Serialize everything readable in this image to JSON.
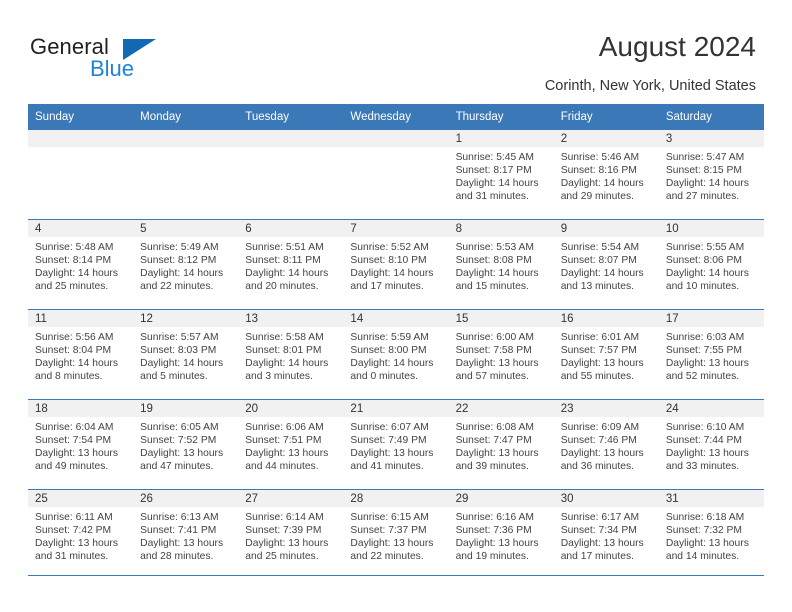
{
  "brand": {
    "name_part1": "General",
    "name_part2": "Blue",
    "accent_color": "#1f83d6",
    "triangle_color": "#1268b3"
  },
  "header": {
    "title": "August 2024",
    "location": "Corinth, New York, United States"
  },
  "calendar": {
    "header_bg": "#3b78b7",
    "daynum_bg": "#f1f1f1",
    "weekdays": [
      "Sunday",
      "Monday",
      "Tuesday",
      "Wednesday",
      "Thursday",
      "Friday",
      "Saturday"
    ],
    "labels": {
      "sunrise": "Sunrise:",
      "sunset": "Sunset:",
      "daylight": "Daylight:"
    },
    "weeks": [
      [
        {
          "day": "",
          "sunrise": "",
          "sunset": "",
          "daylight": ""
        },
        {
          "day": "",
          "sunrise": "",
          "sunset": "",
          "daylight": ""
        },
        {
          "day": "",
          "sunrise": "",
          "sunset": "",
          "daylight": ""
        },
        {
          "day": "",
          "sunrise": "",
          "sunset": "",
          "daylight": ""
        },
        {
          "day": "1",
          "sunrise": "Sunrise: 5:45 AM",
          "sunset": "Sunset: 8:17 PM",
          "daylight": "Daylight: 14 hours and 31 minutes."
        },
        {
          "day": "2",
          "sunrise": "Sunrise: 5:46 AM",
          "sunset": "Sunset: 8:16 PM",
          "daylight": "Daylight: 14 hours and 29 minutes."
        },
        {
          "day": "3",
          "sunrise": "Sunrise: 5:47 AM",
          "sunset": "Sunset: 8:15 PM",
          "daylight": "Daylight: 14 hours and 27 minutes."
        }
      ],
      [
        {
          "day": "4",
          "sunrise": "Sunrise: 5:48 AM",
          "sunset": "Sunset: 8:14 PM",
          "daylight": "Daylight: 14 hours and 25 minutes."
        },
        {
          "day": "5",
          "sunrise": "Sunrise: 5:49 AM",
          "sunset": "Sunset: 8:12 PM",
          "daylight": "Daylight: 14 hours and 22 minutes."
        },
        {
          "day": "6",
          "sunrise": "Sunrise: 5:51 AM",
          "sunset": "Sunset: 8:11 PM",
          "daylight": "Daylight: 14 hours and 20 minutes."
        },
        {
          "day": "7",
          "sunrise": "Sunrise: 5:52 AM",
          "sunset": "Sunset: 8:10 PM",
          "daylight": "Daylight: 14 hours and 17 minutes."
        },
        {
          "day": "8",
          "sunrise": "Sunrise: 5:53 AM",
          "sunset": "Sunset: 8:08 PM",
          "daylight": "Daylight: 14 hours and 15 minutes."
        },
        {
          "day": "9",
          "sunrise": "Sunrise: 5:54 AM",
          "sunset": "Sunset: 8:07 PM",
          "daylight": "Daylight: 14 hours and 13 minutes."
        },
        {
          "day": "10",
          "sunrise": "Sunrise: 5:55 AM",
          "sunset": "Sunset: 8:06 PM",
          "daylight": "Daylight: 14 hours and 10 minutes."
        }
      ],
      [
        {
          "day": "11",
          "sunrise": "Sunrise: 5:56 AM",
          "sunset": "Sunset: 8:04 PM",
          "daylight": "Daylight: 14 hours and 8 minutes."
        },
        {
          "day": "12",
          "sunrise": "Sunrise: 5:57 AM",
          "sunset": "Sunset: 8:03 PM",
          "daylight": "Daylight: 14 hours and 5 minutes."
        },
        {
          "day": "13",
          "sunrise": "Sunrise: 5:58 AM",
          "sunset": "Sunset: 8:01 PM",
          "daylight": "Daylight: 14 hours and 3 minutes."
        },
        {
          "day": "14",
          "sunrise": "Sunrise: 5:59 AM",
          "sunset": "Sunset: 8:00 PM",
          "daylight": "Daylight: 14 hours and 0 minutes."
        },
        {
          "day": "15",
          "sunrise": "Sunrise: 6:00 AM",
          "sunset": "Sunset: 7:58 PM",
          "daylight": "Daylight: 13 hours and 57 minutes."
        },
        {
          "day": "16",
          "sunrise": "Sunrise: 6:01 AM",
          "sunset": "Sunset: 7:57 PM",
          "daylight": "Daylight: 13 hours and 55 minutes."
        },
        {
          "day": "17",
          "sunrise": "Sunrise: 6:03 AM",
          "sunset": "Sunset: 7:55 PM",
          "daylight": "Daylight: 13 hours and 52 minutes."
        }
      ],
      [
        {
          "day": "18",
          "sunrise": "Sunrise: 6:04 AM",
          "sunset": "Sunset: 7:54 PM",
          "daylight": "Daylight: 13 hours and 49 minutes."
        },
        {
          "day": "19",
          "sunrise": "Sunrise: 6:05 AM",
          "sunset": "Sunset: 7:52 PM",
          "daylight": "Daylight: 13 hours and 47 minutes."
        },
        {
          "day": "20",
          "sunrise": "Sunrise: 6:06 AM",
          "sunset": "Sunset: 7:51 PM",
          "daylight": "Daylight: 13 hours and 44 minutes."
        },
        {
          "day": "21",
          "sunrise": "Sunrise: 6:07 AM",
          "sunset": "Sunset: 7:49 PM",
          "daylight": "Daylight: 13 hours and 41 minutes."
        },
        {
          "day": "22",
          "sunrise": "Sunrise: 6:08 AM",
          "sunset": "Sunset: 7:47 PM",
          "daylight": "Daylight: 13 hours and 39 minutes."
        },
        {
          "day": "23",
          "sunrise": "Sunrise: 6:09 AM",
          "sunset": "Sunset: 7:46 PM",
          "daylight": "Daylight: 13 hours and 36 minutes."
        },
        {
          "day": "24",
          "sunrise": "Sunrise: 6:10 AM",
          "sunset": "Sunset: 7:44 PM",
          "daylight": "Daylight: 13 hours and 33 minutes."
        }
      ],
      [
        {
          "day": "25",
          "sunrise": "Sunrise: 6:11 AM",
          "sunset": "Sunset: 7:42 PM",
          "daylight": "Daylight: 13 hours and 31 minutes."
        },
        {
          "day": "26",
          "sunrise": "Sunrise: 6:13 AM",
          "sunset": "Sunset: 7:41 PM",
          "daylight": "Daylight: 13 hours and 28 minutes."
        },
        {
          "day": "27",
          "sunrise": "Sunrise: 6:14 AM",
          "sunset": "Sunset: 7:39 PM",
          "daylight": "Daylight: 13 hours and 25 minutes."
        },
        {
          "day": "28",
          "sunrise": "Sunrise: 6:15 AM",
          "sunset": "Sunset: 7:37 PM",
          "daylight": "Daylight: 13 hours and 22 minutes."
        },
        {
          "day": "29",
          "sunrise": "Sunrise: 6:16 AM",
          "sunset": "Sunset: 7:36 PM",
          "daylight": "Daylight: 13 hours and 19 minutes."
        },
        {
          "day": "30",
          "sunrise": "Sunrise: 6:17 AM",
          "sunset": "Sunset: 7:34 PM",
          "daylight": "Daylight: 13 hours and 17 minutes."
        },
        {
          "day": "31",
          "sunrise": "Sunrise: 6:18 AM",
          "sunset": "Sunset: 7:32 PM",
          "daylight": "Daylight: 13 hours and 14 minutes."
        }
      ]
    ]
  }
}
